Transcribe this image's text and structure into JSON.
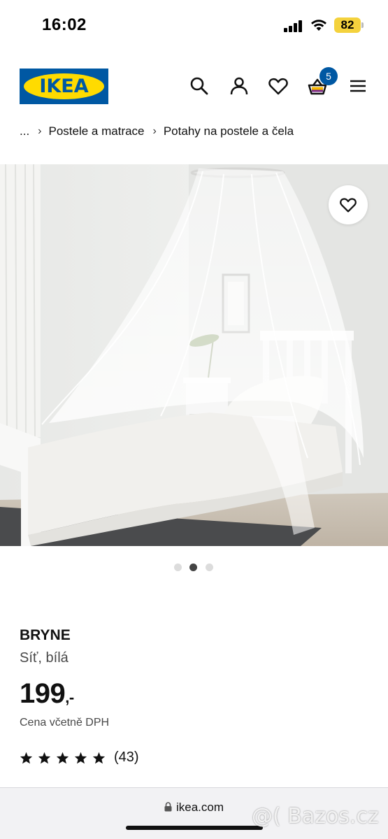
{
  "status_bar": {
    "time": "16:02",
    "battery": "82",
    "icons": [
      "signal-icon",
      "wifi-icon",
      "battery-icon"
    ]
  },
  "header": {
    "logo_text": "IKEA",
    "icons": [
      "search-icon",
      "user-icon",
      "heart-icon",
      "cart-icon",
      "menu-icon"
    ],
    "cart_count": "5",
    "colors": {
      "brand_blue": "#0058a3",
      "brand_yellow": "#ffdb00"
    }
  },
  "breadcrumb": {
    "ellipsis": "...",
    "items": [
      "Postele a matrace",
      "Potahy na postele a čela"
    ]
  },
  "gallery": {
    "image_alt": "BRYNE",
    "dots": 3,
    "active_index": 1
  },
  "product": {
    "name": "BRYNE",
    "description": "Síť, bílá",
    "price": "199",
    "price_suffix": ",-",
    "vat_note": "Cena včetně DPH",
    "rating_stars": 5,
    "rating_count": "(43)"
  },
  "browser": {
    "url": "ikea.com"
  },
  "watermark": "@( Bazos.cz"
}
